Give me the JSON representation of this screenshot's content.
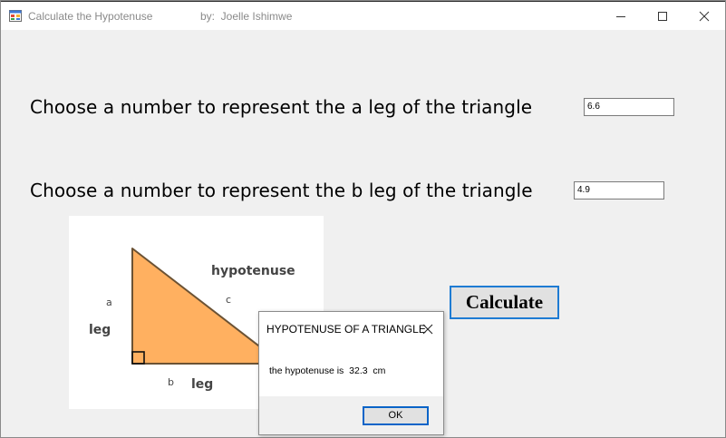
{
  "window": {
    "title": "Calculate the Hypotenuse",
    "author": "by:  Joelle Ishimwe"
  },
  "form": {
    "prompt_a": "Choose a number to represent the a leg of the triangle",
    "value_a": "6.6",
    "prompt_b": "Choose a number to represent the b leg of the triangle",
    "value_b": "4.9",
    "calculate_label": "Calculate"
  },
  "diagram": {
    "hypotenuse_label": "hypotenuse",
    "c_label": "c",
    "a_label": "a",
    "leg_a_label": "leg",
    "b_label": "b",
    "leg_b_label": "leg",
    "fill_color": "#ffb060",
    "stroke_color": "#6b5234"
  },
  "dialog": {
    "title": "HYPOTENUSE OF A TRIANGLE",
    "message": "the hypotenuse is  32.3  cm",
    "ok_label": "OK"
  },
  "icons": [
    "app-icon",
    "minimize-icon",
    "maximize-icon",
    "close-icon",
    "dialog-close-icon"
  ],
  "colors": {
    "accent": "#1e7bd3",
    "window_bg": "#f0f0f0"
  }
}
